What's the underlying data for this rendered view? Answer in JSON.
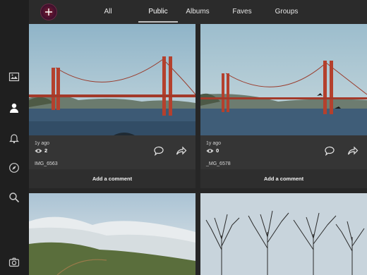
{
  "nav": {
    "tabs": [
      {
        "label": "All",
        "active": false
      },
      {
        "label": "Public",
        "active": true
      },
      {
        "label": "Albums",
        "active": false
      },
      {
        "label": "Faves",
        "active": false
      },
      {
        "label": "Groups",
        "active": false
      }
    ]
  },
  "sidebar": {
    "icons": [
      "image-icon",
      "user-icon",
      "bell-icon",
      "compass-icon",
      "search-icon",
      "camera-icon"
    ],
    "active": "user-icon"
  },
  "photos": [
    {
      "time": "1y ago",
      "views": "2",
      "title": "IMG_6563",
      "comment_label": "Add a comment",
      "subject": "golden-gate-bridge"
    },
    {
      "time": "1y ago",
      "views": "0",
      "title": "_MG_6578",
      "comment_label": "Add a comment",
      "subject": "golden-gate-bridge-with-birds"
    },
    {
      "subject": "foggy-hillside"
    },
    {
      "subject": "bare-trees"
    }
  ],
  "colors": {
    "accent_bg": "#262626",
    "sidebar": "#1f1f1f",
    "topbar": "#2b2b2b",
    "card": "#353535"
  }
}
